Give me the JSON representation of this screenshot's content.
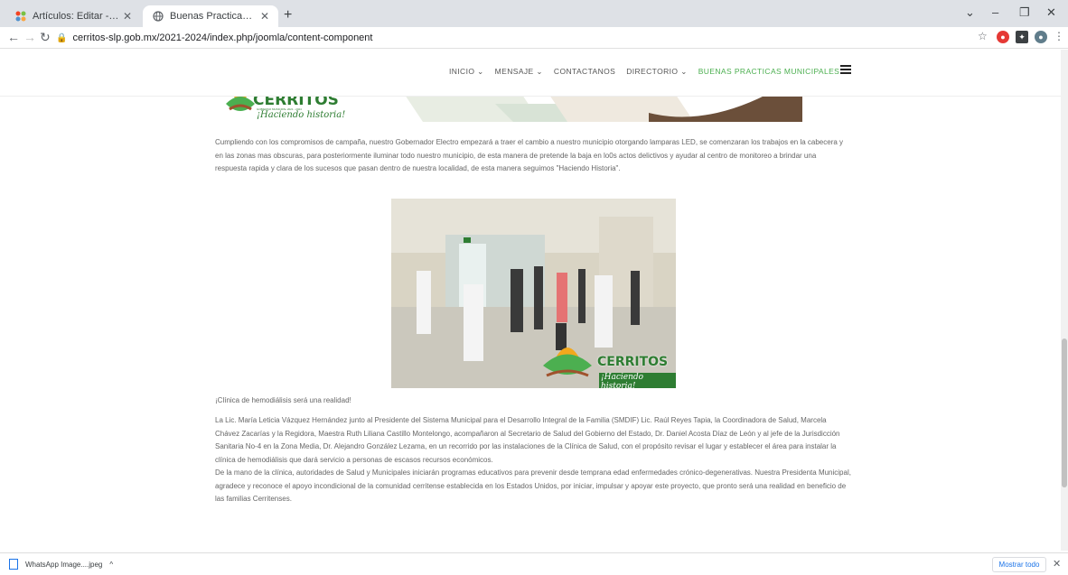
{
  "browser": {
    "tabs": [
      {
        "title": "Artículos: Editar - H. Ayuntamien",
        "favicon": "joomla-icon"
      },
      {
        "title": "Buenas Practicas Municipales",
        "favicon": "globe-icon"
      }
    ],
    "new_tab": "+",
    "url": "cerritos-slp.gob.mx/2021-2024/index.php/joomla/content-component",
    "controls": {
      "minimize": "–",
      "restore": "❐",
      "close": "✕",
      "tab_search": "⌄"
    }
  },
  "site": {
    "menu": [
      {
        "label": "INICIO ⌄"
      },
      {
        "label": "MENSAJE ⌄"
      },
      {
        "label": "CONTACTANOS"
      },
      {
        "label": "DIRECTORIO ⌄"
      },
      {
        "label": "BUENAS PRACTICAS MUNICIPALES ⌄",
        "active": true
      }
    ],
    "logo": {
      "name": "CERRITOS",
      "subtitle": "GOBIERNO MUNICIPAL 2021 - 2024",
      "slogan": "¡Haciendo historia!"
    }
  },
  "article": {
    "intro": "Cumpliendo con los compromisos de campaña, nuestro Gobernador Electro empezará a traer el cambio a nuestro municipio otorgando lamparas LED, se comenzaran los trabajos en la cabecera y en las zonas mas obscuras, para posteriormente iluminar todo nuestro municipio, de esta manera de pretende la baja en lo0s actos delictivos y ayudar al centro de monitoreo a brindar una respuesta rapida y clara de los sucesos que pasan dentro de nuestra localidad, de esta manera seguimos \"Haciendo Historia\".",
    "photo_logo": "CERRITOS",
    "photo_slogan": "¡Haciendo historia!",
    "caption": "¡Clínica de hemodiálisis será una realidad!",
    "body1": "La Lic. María Leticia Vázquez Hernández junto al Presidente del Sistema Municipal para el Desarrollo Integral de la Familia (SMDIF) Lic. Raúl Reyes Tapia, la Coordinadora de Salud, Marcela Chávez Zacarías y la Regidora, Maestra Ruth Liliana Castillo Montelongo, acompañaron al Secretario de Salud del Gobierno del Estado, Dr. Daniel Acosta Díaz de León y al jefe de la Jurisdicción Sanitaria No-4 en la Zona Media, Dr. Alejandro González Lezama, en un recorrido por las instalaciones de la Clínica de Salud, con el propósito revisar el lugar y establecer el área para instalar la clínica de hemodiálisis que dará servicio a personas de escasos recursos económicos.",
    "body2": "De la mano de la clínica, autoridades de Salud y Municipales iniciarán programas educativos para prevenir desde temprana edad enfermedades crónico-degenerativas. Nuestra Presidenta Municipal, agradece y reconoce el apoyo incondicional de la comunidad cerritense establecida en los Estados Unidos, por iniciar, impulsar y apoyar este proyecto, que pronto será una realidad en beneficio de las familias Cerritenses."
  },
  "downloads": {
    "file": "WhatsApp Image....jpeg",
    "show_all": "Mostrar todo"
  },
  "colors": {
    "accent_green": "#4caf50",
    "logo_green": "#2e7d32",
    "link_blue": "#1a73e8"
  }
}
